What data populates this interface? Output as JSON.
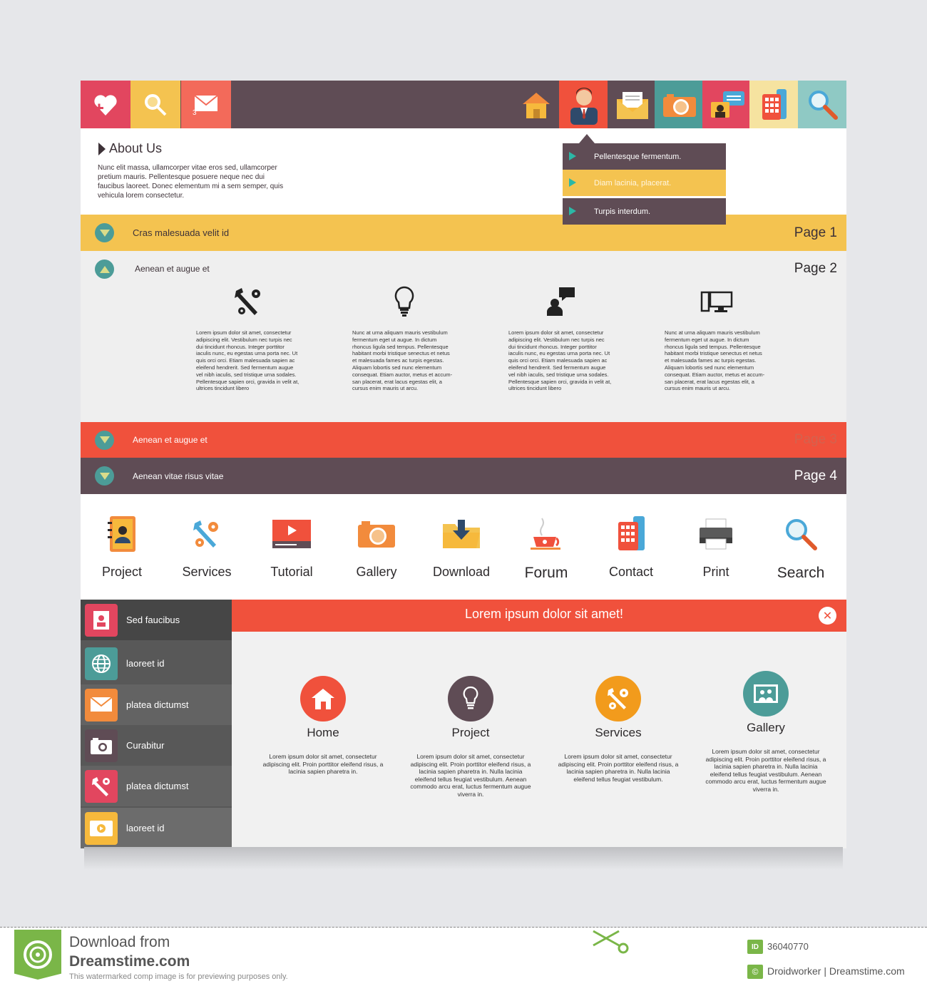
{
  "about": {
    "title": "About Us",
    "text": "Nunc elit massa, ullamcorper vitae eros sed, ullamcorper pretium mauris. Pellentesque posuere neque nec dui faucibus laoreet. Donec elementum mi a sem semper, quis vehicula lorem consectetur."
  },
  "dropdown": {
    "items": [
      "Pellentesque fermentum.",
      "Diam lacinia, placerat.",
      "Turpis interdum."
    ]
  },
  "accordion": [
    {
      "label": "Cras malesuada velit id",
      "page": "Page 1"
    },
    {
      "label": "Aenean et augue et",
      "page": "Page 2"
    },
    {
      "label": "Aenean et augue et",
      "page": "Page 3"
    },
    {
      "label": "Aenean vitae risus vitae",
      "page": "Page 4"
    }
  ],
  "page2_columns": [
    {
      "icon": "tools-icon",
      "text": "Lorem ipsum dolor sit amet, consectetur adipiscing elit. Vestibulum nec turpis nec dui tincidunt rhoncus. Integer porttitor iaculis nunc, eu egestas urna porta nec. Ut quis orci orci. Etiam malesuada sapien ac eleifend hendrerit. Sed fermentum augue vel nibh iaculis, sed tristique urna sodales. Pellentesque sapien orci, gravida in velit at, ultrices tincidunt libero"
    },
    {
      "icon": "lightbulb-icon",
      "text": "Nunc at urna aliquam mauris vestibulum fermentum eget ut augue. In dictum rhoncus ligula sed tempus. Pellentesque habitant morbi tristique senectus et netus et malesuada fames ac turpis egestas. Aliquam lobortis sed nunc elementum consequat. Etiam auctor, metus et accum-san placerat, erat lacus egestas elit, a cursus enim mauris ut arcu."
    },
    {
      "icon": "person-chat-icon",
      "text": "Lorem ipsum dolor sit amet, consectetur adipiscing elit. Vestibulum nec turpis nec dui tincidunt rhoncus. Integer porttitor iaculis nunc, eu egestas urna porta nec. Ut quis orci orci. Etiam malesuada sapien ac eleifend hendrerit. Sed fermentum augue vel nibh iaculis, sed tristique urna sodales. Pellentesque sapien orci, gravida in velit at, ultrices tincidunt libero"
    },
    {
      "icon": "computer-icon",
      "text": "Nunc at urna aliquam mauris vestibulum fermentum eget ut augue. In dictum rhoncus ligula sed tempus. Pellentesque habitant morbi tristique senectus et netus et malesuada fames ac turpis egestas. Aliquam lobortis sed nunc elementum consequat. Etiam auctor, metus et accum-san placerat, erat lacus egestas elit, a cursus enim mauris ut arcu."
    }
  ],
  "nav": [
    "Project",
    "Services",
    "Tutorial",
    "Gallery",
    "Download",
    "Forum",
    "Contact",
    "Print",
    "Search"
  ],
  "sidebar": [
    "Sed faucibus",
    "laoreet id",
    "platea  dictumst",
    "Curabitur",
    "platea  dictumst",
    "laoreet id"
  ],
  "banner": {
    "text": "Lorem ipsum dolor sit amet!",
    "close": "✕"
  },
  "features": [
    {
      "title": "Home",
      "text": "Lorem ipsum dolor sit amet, consectetur adipiscing elit. Proin porttitor eleifend risus, a lacinia sapien pharetra in."
    },
    {
      "title": "Project",
      "text": "Lorem ipsum dolor sit amet, consectetur adipiscing elit. Proin porttitor eleifend risus, a lacinia sapien pharetra in. Nulla lacinia eleifend tellus feugiat vestibulum. Aenean commodo arcu erat, luctus fermentum augue viverra in."
    },
    {
      "title": "Services",
      "text": "Lorem ipsum dolor sit amet, consectetur adipiscing elit. Proin porttitor eleifend risus, a lacinia sapien pharetra in. Nulla lacinia eleifend tellus feugiat vestibulum."
    },
    {
      "title": "Gallery",
      "text": "Lorem ipsum dolor sit amet, consectetur adipiscing elit. Proin porttitor eleifend risus, a lacinia sapien pharetra in. Nulla lacinia eleifend tellus feugiat vestibulum. Aenean commodo arcu erat, luctus fermentum augue viverra in."
    }
  ],
  "footer": {
    "download_from": "Download from",
    "site": "Dreamstime.com",
    "note": "This watermarked comp image is for previewing purposes only.",
    "id_label": "ID",
    "id": "36040770",
    "copyright_symbol": "©",
    "credit": "Droidworker | Dreamstime.com"
  },
  "colors": {
    "plum": "#5f4c55",
    "yellow": "#f4c350",
    "red": "#f0513c",
    "teal": "#4c9c98",
    "pink": "#e2465f"
  }
}
